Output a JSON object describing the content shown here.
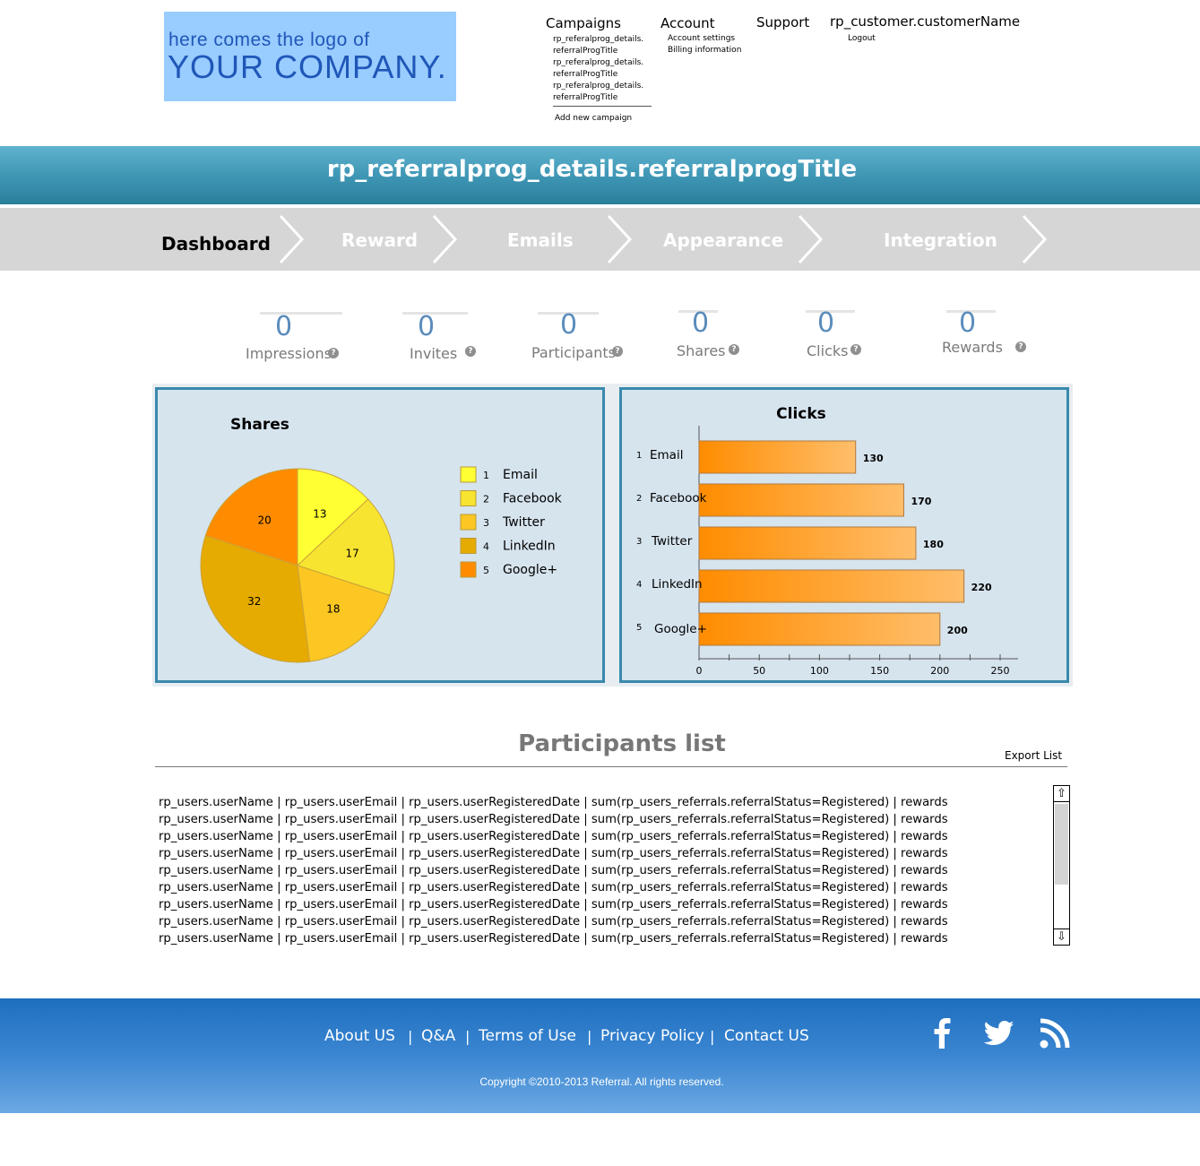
{
  "logo": {
    "line1": "here comes the logo of",
    "line2": "YOUR COMPANY."
  },
  "topnav": {
    "campaigns": {
      "label": "Campaigns",
      "items": [
        "rp_referalprog_details.",
        "referralProgTitle",
        "rp_referalprog_details.",
        "referralProgTitle",
        "rp_referalprog_details.",
        "referralProgTitle"
      ],
      "add_new": "Add new campaign"
    },
    "account": {
      "label": "Account",
      "items": [
        "Account settings",
        "Billing information"
      ]
    },
    "support": {
      "label": "Support"
    },
    "customer": {
      "label": "rp_customer.customerName",
      "logout": "Logout"
    }
  },
  "title": "rp_referralprog_details.referralprogTitle",
  "steps": [
    "Dashboard",
    "Reward",
    "Emails",
    "Appearance",
    "Integration"
  ],
  "stats": [
    {
      "value": "0",
      "label": "Impressions"
    },
    {
      "value": "0",
      "label": "Invites"
    },
    {
      "value": "0",
      "label": "Participants"
    },
    {
      "value": "0",
      "label": "Shares"
    },
    {
      "value": "0",
      "label": "Clicks"
    },
    {
      "value": "0",
      "label": "Rewards"
    }
  ],
  "help_glyph": "?",
  "chart_data": [
    {
      "type": "pie",
      "title": "Shares",
      "categories": [
        "Email",
        "Facebook",
        "Twitter",
        "LinkedIn",
        "Google+"
      ],
      "values": [
        13,
        17,
        18,
        32,
        20
      ],
      "colors": [
        "#ffff33",
        "#f7e430",
        "#fcc722",
        "#e6ab00",
        "#ff8c00"
      ],
      "legend": "right"
    },
    {
      "type": "bar",
      "orientation": "horizontal",
      "title": "Clicks",
      "categories": [
        "Email",
        "Facebook",
        "Twitter",
        "LinkedIn",
        "Google+"
      ],
      "values": [
        130,
        170,
        180,
        220,
        200
      ],
      "xlim": [
        0,
        250
      ],
      "xticks": [
        0,
        50,
        100,
        150,
        200,
        250
      ],
      "colors": [
        "#ff8c00",
        "#ffbe6a"
      ]
    }
  ],
  "participants": {
    "title": "Participants list",
    "export_label": "Export List",
    "rows": [
      "rp_users.userName | rp_users.userEmail | rp_users.userRegisteredDate | sum(rp_users_referrals.referralStatus=Registered) | rewards",
      "rp_users.userName | rp_users.userEmail | rp_users.userRegisteredDate | sum(rp_users_referrals.referralStatus=Registered) | rewards",
      "rp_users.userName | rp_users.userEmail | rp_users.userRegisteredDate | sum(rp_users_referrals.referralStatus=Registered) | rewards",
      "rp_users.userName | rp_users.userEmail | rp_users.userRegisteredDate | sum(rp_users_referrals.referralStatus=Registered) | rewards",
      "rp_users.userName | rp_users.userEmail | rp_users.userRegisteredDate | sum(rp_users_referrals.referralStatus=Registered) | rewards",
      "rp_users.userName | rp_users.userEmail | rp_users.userRegisteredDate | sum(rp_users_referrals.referralStatus=Registered) | rewards",
      "rp_users.userName | rp_users.userEmail | rp_users.userRegisteredDate | sum(rp_users_referrals.referralStatus=Registered) | rewards",
      "rp_users.userName | rp_users.userEmail | rp_users.userRegisteredDate | sum(rp_users_referrals.referralStatus=Registered) | rewards",
      "rp_users.userName | rp_users.userEmail | rp_users.userRegisteredDate | sum(rp_users_referrals.referralStatus=Registered) | rewards"
    ],
    "scroll_up": "⇧",
    "scroll_down": "⇩"
  },
  "footer": {
    "links": [
      "About  US",
      "Q&A",
      "Terms of Use",
      "Privacy Policy",
      "Contact US"
    ],
    "separator": "|",
    "copyright": "Copyright ©2010-2013 Referral. All rights reserved.",
    "social_icons": [
      "facebook-icon",
      "twitter-icon",
      "rss-icon"
    ]
  }
}
